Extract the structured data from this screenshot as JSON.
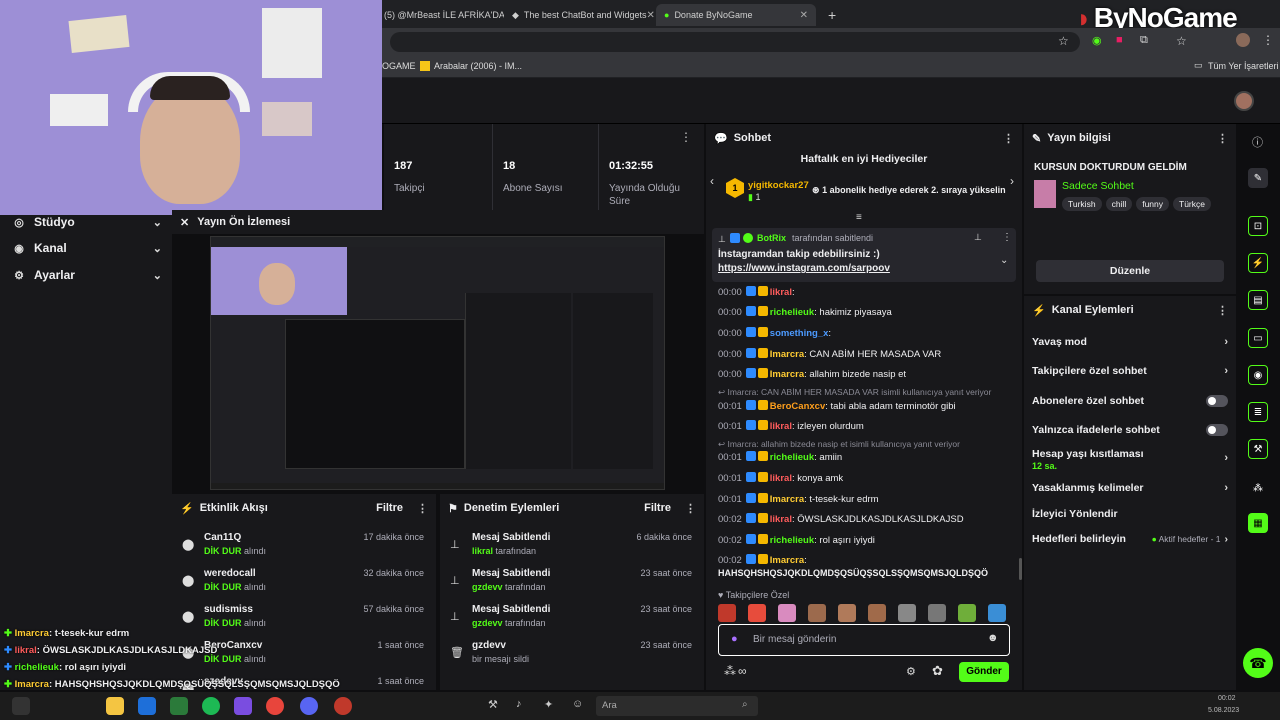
{
  "browser": {
    "tabs": [
      {
        "title": "(5) @MrBeast İLE AFRİKA'DA"
      },
      {
        "title": "The best ChatBot and Widgets"
      },
      {
        "title": "Donate ByNoGame"
      }
    ],
    "new_tab": "+",
    "bookmarks": [
      "OGAME",
      "Arabalar (2006) - IM..."
    ],
    "all_bookmarks": "Tüm Yer İşaretleri"
  },
  "brand": {
    "logo_text": "ByNoGame"
  },
  "nav": {
    "items": [
      {
        "label": "Stüdyo",
        "icon": "studio-icon"
      },
      {
        "label": "Kanal",
        "icon": "channel-icon"
      },
      {
        "label": "Ayarlar",
        "icon": "gear-icon"
      }
    ]
  },
  "stats": [
    {
      "value": "187",
      "label": "Takipçi"
    },
    {
      "value": "18",
      "label": "Abone Sayısı"
    },
    {
      "value": "01:32:55",
      "label": "Yayında Olduğu Süre"
    }
  ],
  "preview": {
    "title": "Yayın Ön İzlemesi"
  },
  "activity": {
    "title": "Etkinlik Akışı",
    "filter": "Filtre",
    "rows": [
      {
        "name": "Can11Q",
        "action": "DİK DUR",
        "suffix": "alındı",
        "time": "17 dakika önce"
      },
      {
        "name": "weredocall",
        "action": "DİK DUR",
        "suffix": "alındı",
        "time": "32 dakika önce"
      },
      {
        "name": "sudismiss",
        "action": "DİK DUR",
        "suffix": "alındı",
        "time": "57 dakika önce"
      },
      {
        "name": "BeroCanxcv",
        "action": "DİK DUR",
        "suffix": "alındı",
        "time": "1 saat önce"
      },
      {
        "name": "szedevv",
        "action": "",
        "suffix": "",
        "time": "1 saat önce"
      }
    ]
  },
  "moderation": {
    "title": "Denetim Eylemleri",
    "filter": "Filtre",
    "rows": [
      {
        "name": "Mesaj Sabitlendi",
        "user": "likral",
        "suffix": "tarafından",
        "time": "6 dakika önce"
      },
      {
        "name": "Mesaj Sabitlendi",
        "user": "gzdevv",
        "suffix": "tarafından",
        "time": "23 saat önce"
      },
      {
        "name": "Mesaj Sabitlendi",
        "user": "gzdevv",
        "suffix": "tarafından",
        "time": "23 saat önce"
      },
      {
        "name": "gzdevv",
        "user": "",
        "suffix": "bir mesajı sildi",
        "time": "23 saat önce"
      }
    ]
  },
  "chat": {
    "title": "Sohbet",
    "leaderboard_title": "Haftalık en iyi Hediyeciler",
    "leader": {
      "rank": "1",
      "name": "yigitkockar27",
      "count": "1",
      "note": "1 abonelik hediye ederek 2. sıraya yükselin"
    },
    "pinned": {
      "by": "BotRix",
      "by_suffix": "tarafından sabitlendi",
      "text": "İnstagramdan takip edebilirsiniz :)",
      "link": "https://www.instagram.com/sarpoov"
    },
    "messages": [
      {
        "time": "00:00",
        "user": "likral",
        "color": "#ff5c5c",
        "text": ""
      },
      {
        "time": "00:00",
        "user": "richelieuk",
        "color": "#53fc18",
        "text": "hakimiz piyasaya"
      },
      {
        "time": "00:00",
        "user": "something_x",
        "color": "#4c9aff",
        "text": ""
      },
      {
        "time": "00:00",
        "user": "Imarcra",
        "color": "#ffcc33",
        "text": "CAN ABİM HER MASADA VAR"
      },
      {
        "time": "00:00",
        "user": "Imarcra",
        "color": "#ffcc33",
        "text": "allahim bizede nasip et"
      },
      {
        "time": "00:01",
        "user": "BeroCanxcv",
        "color": "#ff9f1c",
        "text": "tabi abla adam terminotör gibi"
      },
      {
        "time": "00:01",
        "user": "likral",
        "color": "#ff5c5c",
        "text": "izleyen olurdum"
      },
      {
        "time": "00:01",
        "user": "richelieuk",
        "color": "#53fc18",
        "text": "amiin"
      },
      {
        "time": "00:01",
        "user": "likral",
        "color": "#ff5c5c",
        "text": "konya amk"
      },
      {
        "time": "00:01",
        "user": "Imarcra",
        "color": "#ffcc33",
        "text": "t-tesek-kur edrm"
      },
      {
        "time": "00:02",
        "user": "likral",
        "color": "#ff5c5c",
        "text": "ÖWSLASKJDLKASJDLKASJLDKAJSD"
      },
      {
        "time": "00:02",
        "user": "richelieuk",
        "color": "#53fc18",
        "text": "rol aşırı iyiydi"
      },
      {
        "time": "00:02",
        "user": "Imarcra",
        "color": "#ffcc33",
        "text": ""
      }
    ],
    "replies": [
      "Imarcra: CAN ABİM HER MASADA VAR isimli kullanıcıya yanıt veriyor",
      "Imarcra: allahim bizede nasip et isimli kullanıcıya yanıt veriyor"
    ],
    "last_line": "HAHSQHSHQSJQKDLQMDŞQSÜQŞSQLSŞQMSQMSJQLDŞQÖ",
    "followers_only": "Takipçilere Özel",
    "input_placeholder": "Bir mesaj gönderin",
    "send": "Gönder"
  },
  "stream_info": {
    "title": "Yayın bilgisi",
    "stream_title": "KURSUN DOKTURDUM GELDİM",
    "category": "Sadece Sohbet",
    "tags": [
      "Turkish",
      "chill",
      "funny",
      "Türkçe"
    ],
    "edit": "Düzenle"
  },
  "channel_actions": {
    "title": "Kanal Eylemleri",
    "rows": [
      {
        "label": "Yavaş mod",
        "type": "chevron",
        "sub": ""
      },
      {
        "label": "Takipçilere özel sohbet",
        "type": "chevron",
        "sub": ""
      },
      {
        "label": "Abonelere özel sohbet",
        "type": "toggle",
        "sub": ""
      },
      {
        "label": "Yalnızca ifadelerle sohbet",
        "type": "toggle",
        "sub": ""
      },
      {
        "label": "Hesap yaşı kısıtlaması",
        "type": "chevron",
        "sub": "12 sa."
      },
      {
        "label": "Yasaklanmış kelimeler",
        "type": "chevron",
        "sub": ""
      },
      {
        "label": "İzleyici Yönlendir",
        "type": "none",
        "sub": ""
      },
      {
        "label": "Hedefleri belirleyin",
        "type": "chevron",
        "sub": "Aktif hedefler - 1"
      }
    ]
  },
  "overlay_chat": [
    {
      "user": "Imarcra",
      "color": "#ffcc33",
      "text": "t-tesek-kur edrm"
    },
    {
      "user": "likral",
      "color": "#ff5c5c",
      "text": "ÖWSLASKJDLKASJDLKASJLDKAJSD"
    },
    {
      "user": "richelieuk",
      "color": "#53fc18",
      "text": "rol aşırı iyiydi"
    },
    {
      "user": "Imarcra",
      "color": "#ffcc33",
      "text": "HAHSQHSHQSJQKDLQMDŞQSÜQŞSQLSŞQMSQMSJQLDŞQÖ"
    }
  ],
  "taskbar": {
    "search_placeholder": "Ara",
    "time": "00:02",
    "date": "5.08.2023"
  },
  "colors": {
    "accent": "#53fc18",
    "panel": "#18181b",
    "bg": "#0e0e10"
  }
}
